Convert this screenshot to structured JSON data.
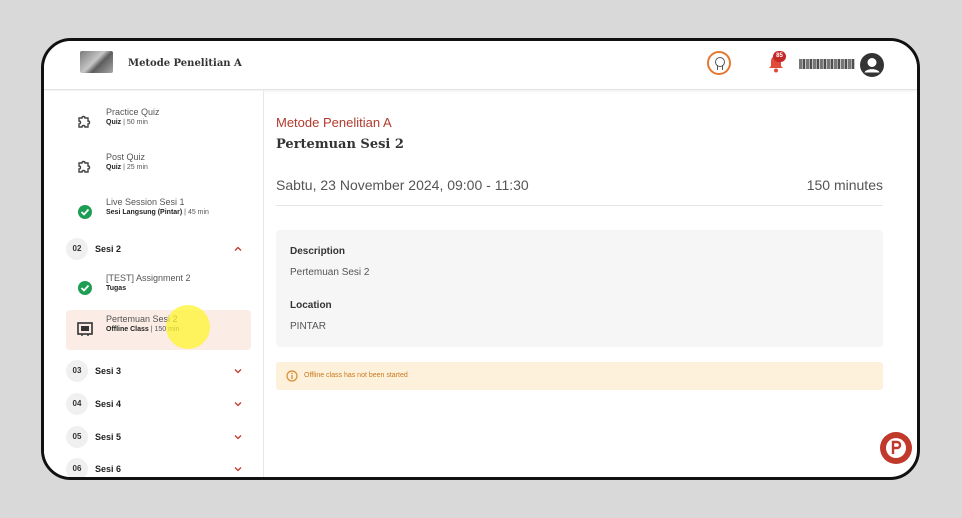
{
  "header": {
    "course_title": "Metode Penelitian A",
    "notification_count": "85"
  },
  "sidebar": {
    "lessons_top": [
      {
        "title": "Practice Quiz",
        "type": "Quiz",
        "duration": " | 50 min",
        "icon": "puzzle-icon"
      },
      {
        "title": "Post Quiz",
        "type": "Quiz",
        "duration": " | 25 min",
        "icon": "puzzle-icon"
      },
      {
        "title": "Live Session Sesi 1",
        "type": "Sesi Langsung (Pintar)",
        "duration": " | 45 min",
        "icon": "check-circle-icon"
      }
    ],
    "section_open": {
      "num": "02",
      "name": "Sesi 2"
    },
    "lessons_section2": [
      {
        "title": "[TEST] Assignment 2",
        "type": "Tugas",
        "duration": "",
        "icon": "check-circle-icon"
      },
      {
        "title": "Pertemuan Sesi 2",
        "type": "Offline Class",
        "duration": " | 150 min",
        "icon": "classroom-icon"
      }
    ],
    "sections_closed": [
      {
        "num": "03",
        "name": "Sesi 3"
      },
      {
        "num": "04",
        "name": "Sesi 4"
      },
      {
        "num": "05",
        "name": "Sesi 5"
      },
      {
        "num": "06",
        "name": "Sesi 6"
      }
    ]
  },
  "main": {
    "course_name": "Metode Penelitian A",
    "session_title": "Pertemuan Sesi 2",
    "schedule": "Sabtu, 23 November 2024, 09:00 - 11:30",
    "duration": "150 minutes",
    "description_label": "Description",
    "description_value": "Pertemuan Sesi 2",
    "location_label": "Location",
    "location_value": "PINTAR",
    "alert_text": "Offline class has not been started"
  },
  "colors": {
    "accent": "#b03a2e",
    "success": "#1e9e55",
    "active_bg": "#fbece6",
    "alert_bg": "#fdf1dc",
    "alert_text": "#c9771a"
  }
}
